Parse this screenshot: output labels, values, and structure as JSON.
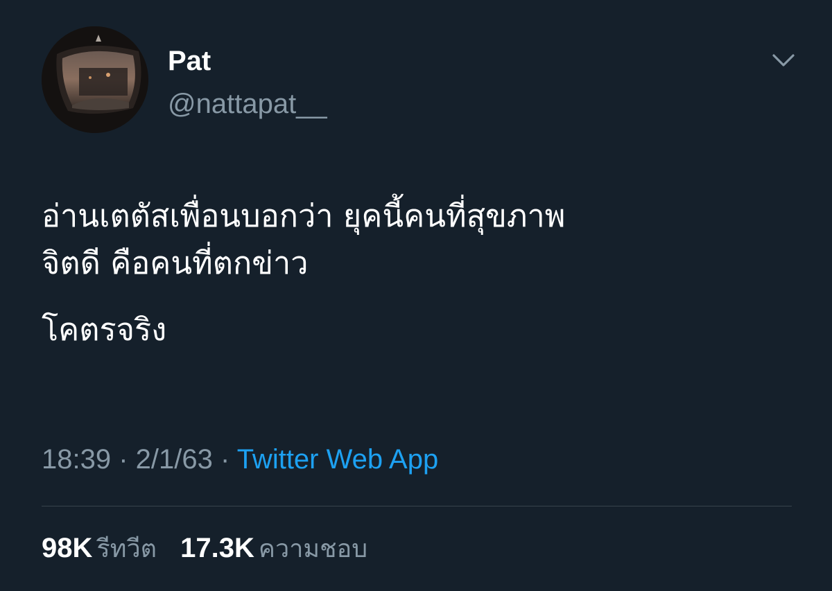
{
  "user": {
    "display_name": "Pat",
    "handle": "@nattapat__"
  },
  "tweet": {
    "line1": "อ่านเตตัสเพื่อนบอกว่า ยุคนี้คนที่สุขภาพ",
    "line2": "จิตดี คือคนที่ตกข่าว",
    "line3": "โคตรจริง",
    "time": "18:39",
    "date": "2/1/63",
    "separator": " · ",
    "source": "Twitter Web App"
  },
  "stats": {
    "retweets_count": "98K",
    "retweets_label": "รีทวีต",
    "likes_count": "17.3K",
    "likes_label": "ความชอบ"
  },
  "icons": {
    "menu": "chevron-down-icon"
  },
  "colors": {
    "background": "#15202b",
    "text": "#ffffff",
    "muted": "#8899a6",
    "link": "#1da1f2",
    "divider": "#38444d"
  }
}
